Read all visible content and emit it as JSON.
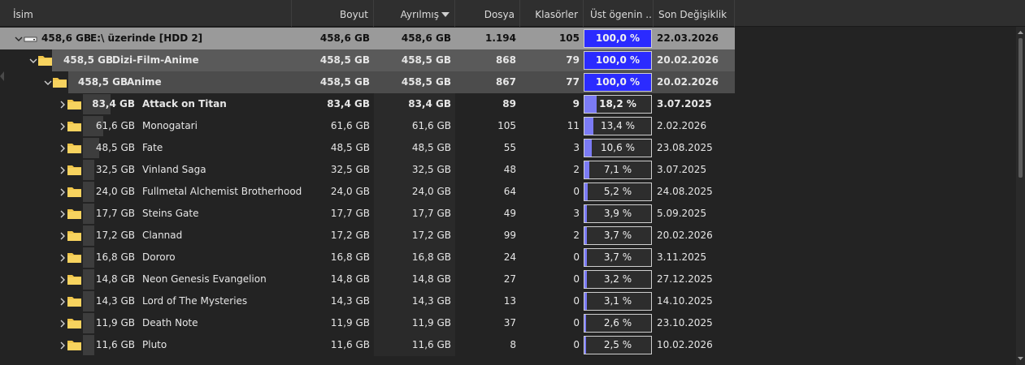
{
  "header": {
    "name": "İsim",
    "size": "Boyut",
    "allocated": "Ayrılmış",
    "files": "Dosya",
    "folders": "Klasörler",
    "parent_pct": "Üst ögenin ...",
    "modified": "Son Değişiklik"
  },
  "colors": {
    "background": "#232323",
    "header": "#2f2f2f",
    "root_row": "#9a9a9a",
    "level1_row": "#5a5a5a",
    "level2_row": "#4c4c4c",
    "pct_fill_full": "#2b2bff",
    "pct_fill": "#7b7bf5"
  },
  "rows": [
    {
      "level": 0,
      "type": "drive",
      "expanded": true,
      "bold": true,
      "size_label": "458,6 GB",
      "name": "E:\\  üzerinde  [HDD 2]",
      "size": "458,6 GB",
      "allocated": "458,6 GB",
      "files": "1.194",
      "folders": "105",
      "pct": "100,0 %",
      "pct_value": 100,
      "modified": "22.03.2026"
    },
    {
      "level": 1,
      "type": "folder",
      "expanded": true,
      "bold": true,
      "size_label": "458,5 GB",
      "name": "Dizi-Film-Anime",
      "size": "458,5 GB",
      "allocated": "458,5 GB",
      "files": "868",
      "folders": "79",
      "pct": "100,0 %",
      "pct_value": 100,
      "modified": "20.02.2026"
    },
    {
      "level": 2,
      "type": "folder",
      "expanded": true,
      "bold": true,
      "size_label": "458,5 GB",
      "name": "Anime",
      "size": "458,5 GB",
      "allocated": "458,5 GB",
      "files": "867",
      "folders": "77",
      "pct": "100,0 %",
      "pct_value": 100,
      "modified": "20.02.2026"
    },
    {
      "level": 3,
      "type": "folder",
      "expanded": false,
      "bold": true,
      "size_label": "83,4 GB",
      "name": "Attack on Titan",
      "size": "83,4 GB",
      "allocated": "83,4 GB",
      "files": "89",
      "folders": "9",
      "pct": "18,2 %",
      "pct_value": 18.2,
      "modified": "3.07.2025"
    },
    {
      "level": 3,
      "type": "folder",
      "expanded": false,
      "bold": false,
      "size_label": "61,6 GB",
      "name": "Monogatari",
      "size": "61,6 GB",
      "allocated": "61,6 GB",
      "files": "105",
      "folders": "11",
      "pct": "13,4 %",
      "pct_value": 13.4,
      "modified": "2.02.2026"
    },
    {
      "level": 3,
      "type": "folder",
      "expanded": false,
      "bold": false,
      "size_label": "48,5 GB",
      "name": "Fate",
      "size": "48,5 GB",
      "allocated": "48,5 GB",
      "files": "55",
      "folders": "3",
      "pct": "10,6 %",
      "pct_value": 10.6,
      "modified": "23.08.2025"
    },
    {
      "level": 3,
      "type": "folder",
      "expanded": false,
      "bold": false,
      "size_label": "32,5 GB",
      "name": "Vinland Saga",
      "size": "32,5 GB",
      "allocated": "32,5 GB",
      "files": "48",
      "folders": "2",
      "pct": "7,1 %",
      "pct_value": 7.1,
      "modified": "3.07.2025"
    },
    {
      "level": 3,
      "type": "folder",
      "expanded": false,
      "bold": false,
      "size_label": "24,0 GB",
      "name": "Fullmetal Alchemist Brotherhood",
      "size": "24,0 GB",
      "allocated": "24,0 GB",
      "files": "64",
      "folders": "0",
      "pct": "5,2 %",
      "pct_value": 5.2,
      "modified": "24.08.2025"
    },
    {
      "level": 3,
      "type": "folder",
      "expanded": false,
      "bold": false,
      "size_label": "17,7 GB",
      "name": "Steins Gate",
      "size": "17,7 GB",
      "allocated": "17,7 GB",
      "files": "49",
      "folders": "3",
      "pct": "3,9 %",
      "pct_value": 3.9,
      "modified": "5.09.2025"
    },
    {
      "level": 3,
      "type": "folder",
      "expanded": false,
      "bold": false,
      "size_label": "17,2 GB",
      "name": "Clannad",
      "size": "17,2 GB",
      "allocated": "17,2 GB",
      "files": "99",
      "folders": "2",
      "pct": "3,7 %",
      "pct_value": 3.7,
      "modified": "20.02.2026"
    },
    {
      "level": 3,
      "type": "folder",
      "expanded": false,
      "bold": false,
      "size_label": "16,8 GB",
      "name": "Dororo",
      "size": "16,8 GB",
      "allocated": "16,8 GB",
      "files": "24",
      "folders": "0",
      "pct": "3,7 %",
      "pct_value": 3.7,
      "modified": "3.11.2025"
    },
    {
      "level": 3,
      "type": "folder",
      "expanded": false,
      "bold": false,
      "size_label": "14,8 GB",
      "name": "Neon Genesis Evangelion",
      "size": "14,8 GB",
      "allocated": "14,8 GB",
      "files": "27",
      "folders": "0",
      "pct": "3,2 %",
      "pct_value": 3.2,
      "modified": "27.12.2025"
    },
    {
      "level": 3,
      "type": "folder",
      "expanded": false,
      "bold": false,
      "size_label": "14,3 GB",
      "name": "Lord of The Mysteries",
      "size": "14,3 GB",
      "allocated": "14,3 GB",
      "files": "13",
      "folders": "0",
      "pct": "3,1 %",
      "pct_value": 3.1,
      "modified": "14.10.2025"
    },
    {
      "level": 3,
      "type": "folder",
      "expanded": false,
      "bold": false,
      "size_label": "11,9 GB",
      "name": "Death Note",
      "size": "11,9 GB",
      "allocated": "11,9 GB",
      "files": "37",
      "folders": "0",
      "pct": "2,6 %",
      "pct_value": 2.6,
      "modified": "23.10.2025"
    },
    {
      "level": 3,
      "type": "folder",
      "expanded": false,
      "bold": false,
      "size_label": "11,6 GB",
      "name": "Pluto",
      "size": "11,6 GB",
      "allocated": "11,6 GB",
      "files": "8",
      "folders": "0",
      "pct": "2,5 %",
      "pct_value": 2.5,
      "modified": "10.02.2026"
    }
  ]
}
